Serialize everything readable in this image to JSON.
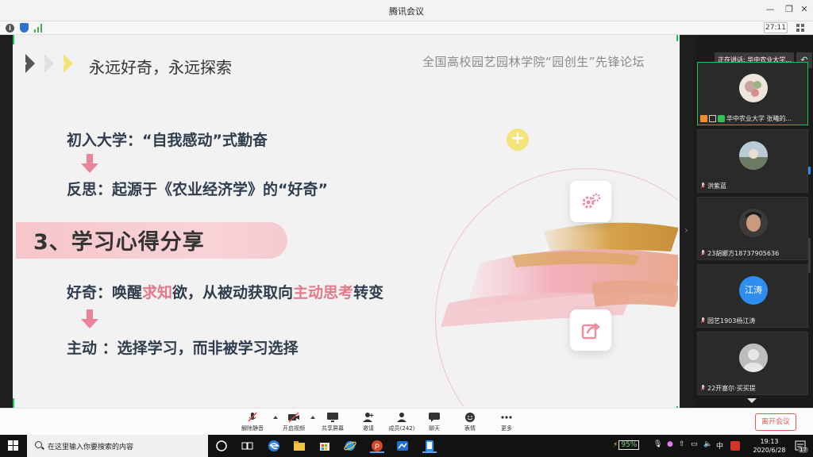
{
  "window": {
    "title": "腾讯会议",
    "timer": "27:11"
  },
  "slide": {
    "title": "永远好奇，永远探索",
    "forum": "全国高校园艺园林学院“园创生”先锋论坛",
    "line1": "初入大学：“自我感动”式勤奋",
    "line2": "反思：起源于《农业经济学》的“好奇”",
    "section": "3、学习心得分享",
    "line3_a": "好奇：唤醒",
    "line3_hl1": "求知",
    "line3_b": "欲，从被动获取向",
    "line3_hl2": "主动思考",
    "line3_c": "转变",
    "line4": "主动 ：选择学习，而非被学习选择",
    "icons": [
      "plus-icon",
      "gear-icon",
      "share-icon"
    ]
  },
  "panel": {
    "speaking": "正在讲话: 华中农业大学...",
    "participants": [
      {
        "name": "华中农业大学 张曦的...",
        "active": true
      },
      {
        "name": "洪紫蓝",
        "active": false
      },
      {
        "name": "23胡娜方18737905636",
        "active": false
      },
      {
        "name": "园艺1903杨江涛",
        "active": false,
        "avatar_text": "江涛"
      },
      {
        "name": "22开塞尔·买买提",
        "active": false
      }
    ]
  },
  "toolbar": {
    "mute": "解除静音",
    "video": "开启视频",
    "share": "共享屏幕",
    "invite": "邀请",
    "members": "成员(242)",
    "chat": "聊天",
    "emoji": "表情",
    "more": "更多",
    "leave": "离开会议"
  },
  "taskbar": {
    "search_placeholder": "在这里输入你要搜索的内容",
    "battle": "95%",
    "ime": "中",
    "time": "19:13",
    "date": "2020/6/28",
    "notify_count": "17"
  },
  "colors": {
    "accent_green": "#1fc35a",
    "leave_red": "#e05a4e",
    "highlight_pink": "#e27a8a",
    "banner_pink": "#f6c5cb",
    "text_dark": "#2f3d4e"
  }
}
